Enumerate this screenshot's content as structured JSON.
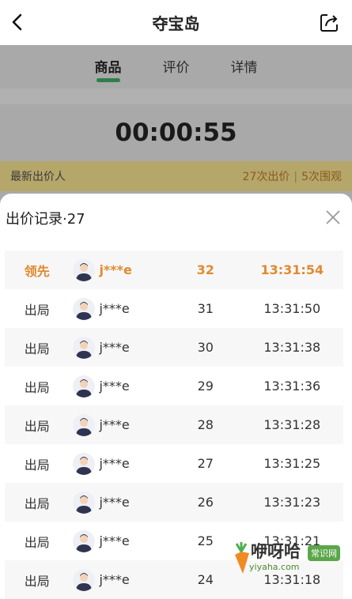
{
  "header": {
    "title": "夺宝岛"
  },
  "tabs": [
    {
      "label": "商品"
    },
    {
      "label": "评价"
    },
    {
      "label": "详情"
    }
  ],
  "timer": "00:00:55",
  "bid_bar": {
    "label": "最新出价人",
    "bids": "27次出价",
    "views": "5次围观"
  },
  "sheet": {
    "title": "出价记录·27",
    "rows": [
      {
        "status": "领先",
        "user": "j***e",
        "amount": "32",
        "time": "13:31:54"
      },
      {
        "status": "出局",
        "user": "j***e",
        "amount": "31",
        "time": "13:31:50"
      },
      {
        "status": "出局",
        "user": "j***e",
        "amount": "30",
        "time": "13:31:38"
      },
      {
        "status": "出局",
        "user": "j***e",
        "amount": "29",
        "time": "13:31:36"
      },
      {
        "status": "出局",
        "user": "j***e",
        "amount": "28",
        "time": "13:31:28"
      },
      {
        "status": "出局",
        "user": "j***e",
        "amount": "27",
        "time": "13:31:25"
      },
      {
        "status": "出局",
        "user": "j***e",
        "amount": "26",
        "time": "13:31:23"
      },
      {
        "status": "出局",
        "user": "j***e",
        "amount": "25",
        "time": "13:31:21"
      },
      {
        "status": "出局",
        "user": "j***e",
        "amount": "24",
        "time": "13:31:18"
      }
    ]
  },
  "watermark": {
    "name": "咿呀哈",
    "badge": "常识网",
    "url": "yiyaha.com"
  },
  "colors": {
    "accent": "#2f7d4d",
    "lead": "#e18a30"
  }
}
